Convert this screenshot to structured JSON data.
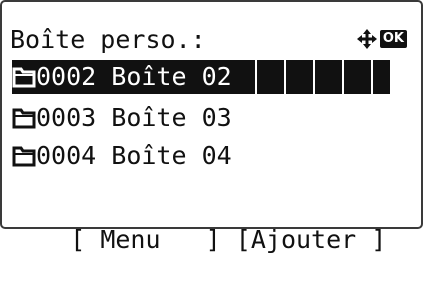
{
  "header": {
    "title": "Boîte perso.:",
    "ok_label": "OK"
  },
  "boxes": [
    {
      "number": "0002",
      "name": "Boîte 02",
      "selected": true
    },
    {
      "number": "0003",
      "name": "Boîte 03",
      "selected": false
    },
    {
      "number": "0004",
      "name": "Boîte 04",
      "selected": false
    }
  ],
  "softkeys": {
    "left": "[ Menu   ]",
    "right": "[Ajouter ]"
  },
  "icons": {
    "folder": "folder-icon",
    "nav": "four-way-arrow-icon"
  }
}
